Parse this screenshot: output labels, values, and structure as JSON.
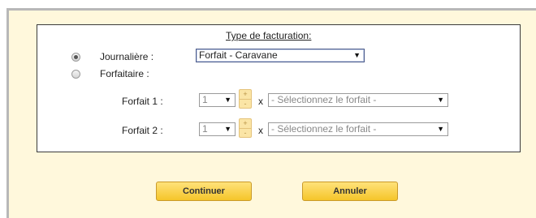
{
  "billing": {
    "title": "Type de facturation:",
    "daily": {
      "label": "Journalière :",
      "selected": true,
      "value": "Forfait - Caravane"
    },
    "flat": {
      "label": "Forfaitaire :",
      "selected": false
    },
    "packages": [
      {
        "label": "Forfait 1 :",
        "qty": "1",
        "multiplier": "x",
        "package": "- Sélectionnez le forfait -"
      },
      {
        "label": "Forfait 2 :",
        "qty": "1",
        "multiplier": "x",
        "package": "- Sélectionnez le forfait -"
      }
    ],
    "spin_plus": "+",
    "spin_minus": "-"
  },
  "actions": {
    "continue": "Continuer",
    "cancel": "Annuler"
  },
  "icons": {
    "dropdown": "chevron-down-icon"
  }
}
